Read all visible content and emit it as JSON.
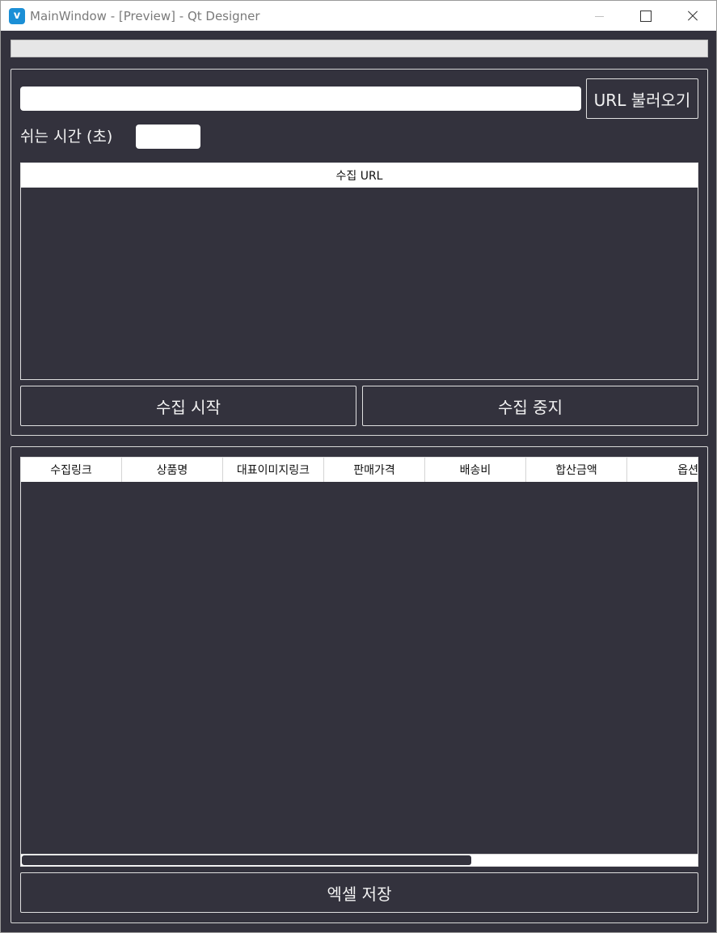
{
  "window": {
    "title": "MainWindow - [Preview] - Qt Designer",
    "icon_letter": "v",
    "icon_color": "#1b8fd6"
  },
  "progress": {
    "value": 0
  },
  "top_panel": {
    "url_value": "",
    "load_button": "URL 불러오기",
    "rest_label": "쉬는 시간 (초)",
    "rest_value": "",
    "url_table_header": "수집 URL",
    "start_button": "수집 시작",
    "stop_button": "수집 중지"
  },
  "results": {
    "columns": [
      "수집링크",
      "상품명",
      "대표이미지링크",
      "판매가격",
      "배송비",
      "합산금액",
      "옵션"
    ],
    "save_button": "엑셀 저장"
  },
  "colors": {
    "background": "#33323d",
    "border": "#e0e0e0",
    "text": "#f2f2f2"
  }
}
